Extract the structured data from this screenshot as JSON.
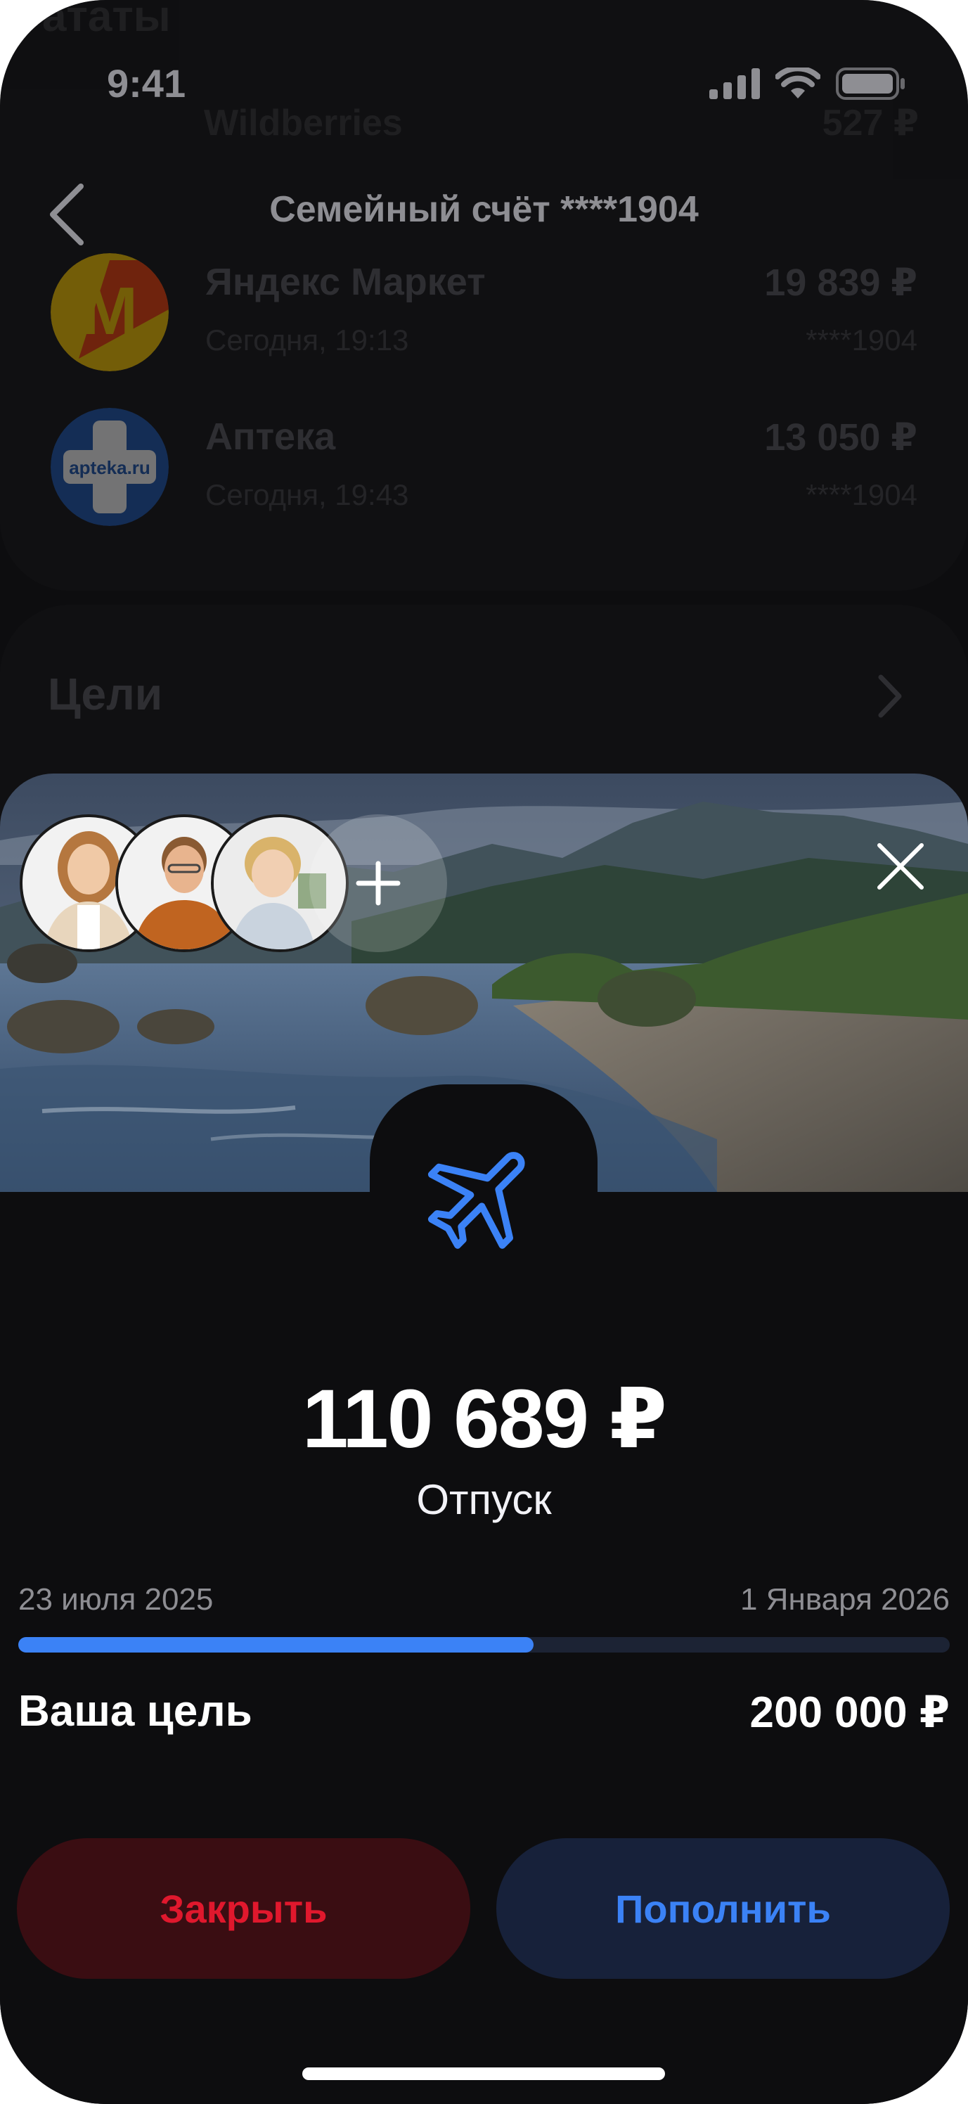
{
  "status_bar": {
    "time": "9:41"
  },
  "nav": {
    "title": "Семейный счёт ****1904"
  },
  "background": {
    "ghost_heading": "ататы",
    "ghost_merchant": "Wildberries",
    "ghost_amount": "527 ₽",
    "transactions": [
      {
        "name": "Яндекс Маркет",
        "time": "Сегодня, 19:13",
        "amount": "19 839 ₽",
        "account": "****1904",
        "logo_text": "М"
      },
      {
        "name": "Аптека",
        "time": "Сегодня, 19:43",
        "amount": "13 050 ₽",
        "account": "****1904",
        "logo_text": "apteka.ru"
      }
    ],
    "goals_title": "Цели"
  },
  "goal": {
    "amount": "110 689 ₽",
    "name": "Отпуск",
    "start_date": "23 июля 2025",
    "end_date": "1 Января 2026",
    "progress_fraction": 0.553,
    "target_label": "Ваша цель",
    "target_value": "200 000 ₽",
    "icon": "airplane-icon"
  },
  "buttons": {
    "close": "Закрыть",
    "topup": "Пополнить"
  },
  "colors": {
    "accent": "#3b82f6",
    "danger": "#e0182d",
    "background": "#0d0d0f"
  }
}
